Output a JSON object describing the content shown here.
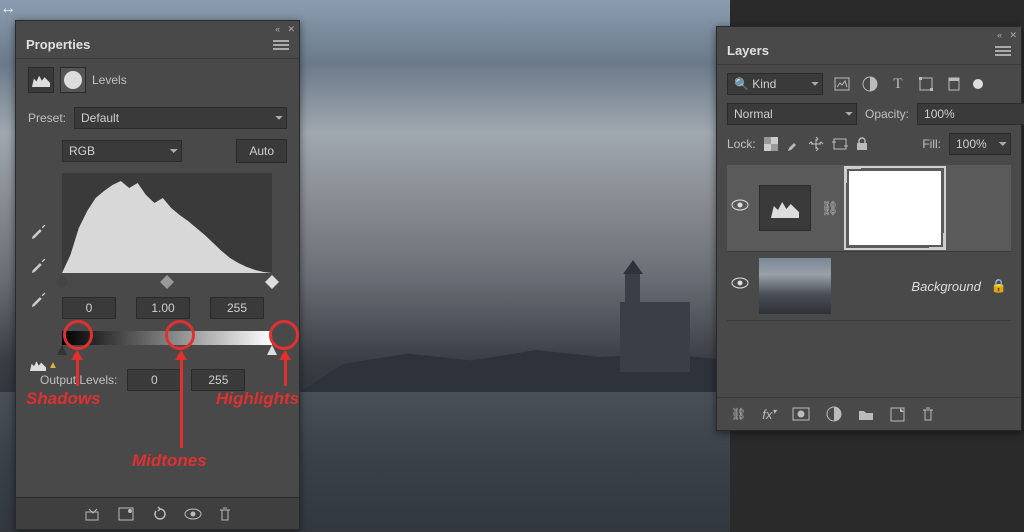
{
  "properties": {
    "panel_title": "Properties",
    "adjustment_label": "Levels",
    "preset_label": "Preset:",
    "preset_value": "Default",
    "channel_value": "RGB",
    "auto_label": "Auto",
    "input_shadow": "0",
    "input_midtone": "1.00",
    "input_highlight": "255",
    "output_label": "Output Levels:",
    "output_low": "0",
    "output_high": "255"
  },
  "annotations": {
    "shadows": "Shadows",
    "midtones": "Midtones",
    "highlights": "Highlights"
  },
  "layers": {
    "panel_title": "Layers",
    "filter_kind": "Kind",
    "blend_mode": "Normal",
    "opacity_label": "Opacity:",
    "opacity_value": "100%",
    "lock_label": "Lock:",
    "fill_label": "Fill:",
    "fill_value": "100%",
    "background_name": "Background"
  }
}
